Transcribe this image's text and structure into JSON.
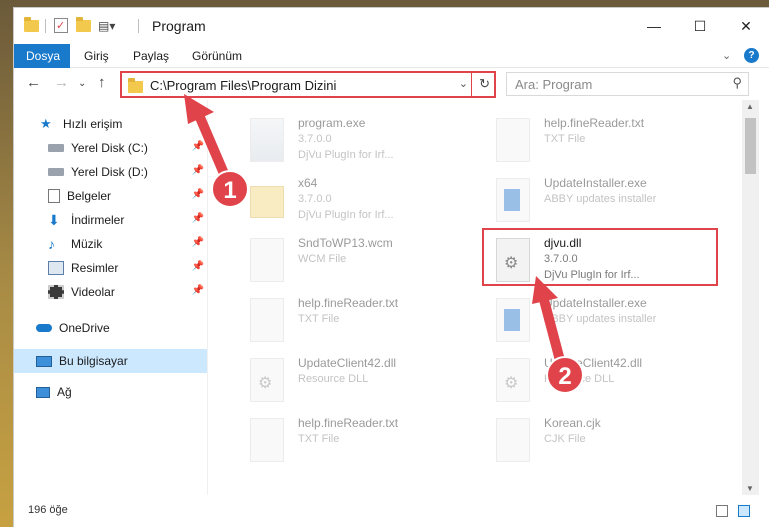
{
  "window": {
    "title": "Program"
  },
  "ribbon": {
    "tabs": [
      {
        "label": "Dosya"
      },
      {
        "label": "Giriş"
      },
      {
        "label": "Paylaş"
      },
      {
        "label": "Görünüm"
      }
    ]
  },
  "navbar": {
    "address_path": "C:\\Program Files\\Program Dizini",
    "search_placeholder": "Ara: Program"
  },
  "sidebar": {
    "items": [
      {
        "label": "Hızlı erişim",
        "icon": "star-icon"
      },
      {
        "label": "Yerel Disk (C:)",
        "icon": "drive-icon"
      },
      {
        "label": "Yerel Disk (D:)",
        "icon": "drive-icon"
      },
      {
        "label": "Belgeler",
        "icon": "documents-icon"
      },
      {
        "label": "İndirmeler",
        "icon": "download-icon"
      },
      {
        "label": "Müzik",
        "icon": "music-icon"
      },
      {
        "label": "Resimler",
        "icon": "pictures-icon"
      },
      {
        "label": "Videolar",
        "icon": "videos-icon"
      },
      {
        "label": "OneDrive",
        "icon": "cloud-icon"
      },
      {
        "label": "Bu bilgisayar",
        "icon": "computer-icon"
      },
      {
        "label": "Ağ",
        "icon": "network-icon"
      }
    ]
  },
  "files": [
    {
      "name": "program.exe",
      "line1": "3.7.0.0",
      "line2": "DjVu PlugIn for Irf...",
      "icon": "app-icon"
    },
    {
      "name": "help.fineReader.txt",
      "line1": "TXT File",
      "line2": "",
      "icon": "text-file-icon"
    },
    {
      "name": "x64",
      "line1": "3.7.0.0",
      "line2": "DjVu PlugIn for Irf...",
      "icon": "folder-icon"
    },
    {
      "name": "UpdateInstaller.exe",
      "line1": "ABBY updates installer",
      "line2": "",
      "icon": "installer-icon"
    },
    {
      "name": "SndToWP13.wcm",
      "line1": "WCM File",
      "line2": "",
      "icon": "file-icon"
    },
    {
      "name": "djvu.dll",
      "line1": "3.7.0.0",
      "line2": "DjVu PlugIn for Irf...",
      "icon": "dll-icon"
    },
    {
      "name": "help.fineReader.txt",
      "line1": "TXT File",
      "line2": "",
      "icon": "text-file-icon"
    },
    {
      "name": "UpdateInstaller.exe",
      "line1": "ABBY updates installer",
      "line2": "",
      "icon": "installer-icon"
    },
    {
      "name": "UpdateClient42.dll",
      "line1": "Resource DLL",
      "line2": "",
      "icon": "dll-icon"
    },
    {
      "name": "UpdateClient42.dll",
      "line1": "Resource DLL",
      "line2": "",
      "icon": "dll-icon"
    },
    {
      "name": "help.fineReader.txt",
      "line1": "TXT File",
      "line2": "",
      "icon": "text-file-icon"
    },
    {
      "name": "Korean.cjk",
      "line1": "CJK File",
      "line2": "",
      "icon": "file-icon"
    }
  ],
  "status": {
    "item_count": "196 öğe"
  },
  "annotations": {
    "step1": "1",
    "step2": "2",
    "color": "#e0434a"
  }
}
